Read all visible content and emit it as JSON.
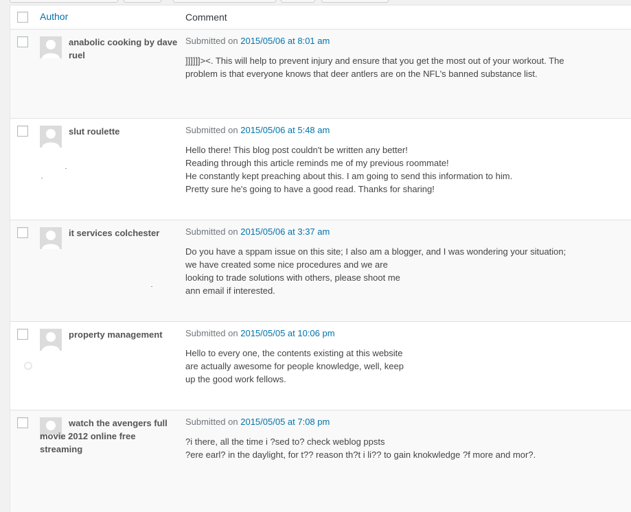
{
  "header": {
    "author_label": "Author",
    "comment_label": "Comment"
  },
  "comments": [
    {
      "author": "anabolic cooking by dave ruel",
      "submitted_prefix": "Submitted on",
      "date": "2015/05/06 at 8:01 am",
      "lines": [
        "]]]]]]><. This will help to prevent injury and ensure that you get the most out of your workout. The",
        "problem is that everyone knows that deer antlers are on the NFL's banned substance list."
      ]
    },
    {
      "author": "slut roulette",
      "submitted_prefix": "Submitted on",
      "date": "2015/05/06 at 5:48 am",
      "lines": [
        "Hello there! This blog post couldn't be written any better!",
        "Reading through this article reminds me of my previous roommate!",
        "He constantly kept preaching about this. I am going to send this information to him.",
        "Pretty sure he's going to have a good read. Thanks for sharing!"
      ]
    },
    {
      "author": "it services colchester",
      "submitted_prefix": "Submitted on",
      "date": "2015/05/06 at 3:37 am",
      "lines": [
        "Do you have a sppam issue on this site; I also am a blogger, and I was wondering your situation;",
        "we have created some nice procedures and we are",
        "looking to trade solutions with others, please shoot me",
        "ann email if interested."
      ]
    },
    {
      "author": "property management",
      "submitted_prefix": "Submitted on",
      "date": "2015/05/05 at 10:06 pm",
      "lines": [
        "Hello to every one, the contents existing at this website",
        "are actually awesome for people knowledge, well, keep",
        "up the good work fellows."
      ]
    },
    {
      "author": "watch the avengers full movie 2012 online free streaming",
      "submitted_prefix": "Submitted on",
      "date": "2015/05/05 at 7:08 pm",
      "lines": [
        "?i there, all the time i ?sed to? check weblog ppsts",
        "?ere earl? in the daylight, for t?? reason th?t i li?? to gain knokwledge ?f more and mor?."
      ]
    }
  ],
  "colors": {
    "link": "#0073aa",
    "alt_row": "#f9f9f9",
    "border": "#e1e1e1"
  }
}
